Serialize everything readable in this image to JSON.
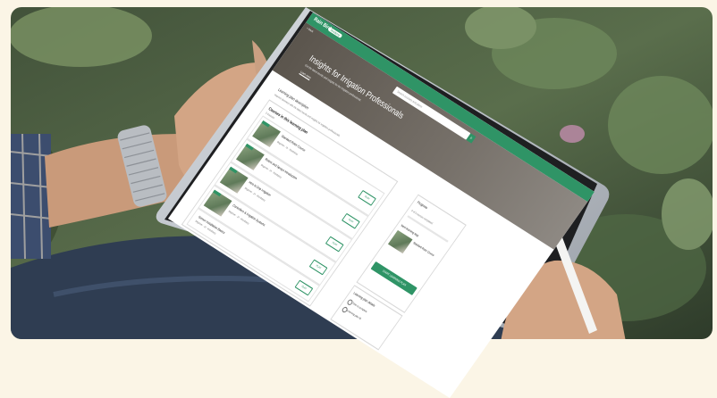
{
  "app": {
    "logo": "Rain Bird",
    "badge": "Academy",
    "back": "< Back"
  },
  "search": {
    "placeholder": "Search courses and plans"
  },
  "hero": {
    "title": "Insights for Irrigation Professionals",
    "subtitle": "Get the latest trends and insights for the irrigation professional.",
    "link": "Learn more"
  },
  "section": {
    "title": "Learning plan description",
    "description": "Improve business with the latest trends and insights for irrigation professionals."
  },
  "plan": {
    "title": "Courses in this learning plan",
    "count": "5 Courses",
    "courses": [
      {
        "title": "Standard Rotor Course",
        "meta": "Beginner · 1h · Mandatory",
        "button": "PLAY"
      },
      {
        "title": "Rotors and Sprays Introduction",
        "meta": "Beginner · 1h · Mandatory",
        "button": "PLAY"
      },
      {
        "title": "Intro to Drip Irrigation",
        "meta": "Beginner · 1h · Mandatory",
        "button": "PLAY"
      },
      {
        "title": "Controllers & Irrigation Systems",
        "meta": "Beginner · 1h · Mandatory",
        "button": "PLAY"
      },
      {
        "title": "Sensor Installation Basics",
        "meta": "Beginner · 1h · Mandatory",
        "button": "PLAY"
      }
    ]
  },
  "progress": {
    "title": "Progress",
    "summary": "0 of 5 courses completed",
    "percent": 0,
    "next_label": "Next learning step",
    "next_title": "Standard Rotor Course",
    "start_button": "START LEARNING PLAN"
  },
  "details": {
    "title": "Learning plan details",
    "items": [
      "Time to complete",
      "Learning plan ID"
    ]
  },
  "colors": {
    "brand": "#2f9466"
  }
}
